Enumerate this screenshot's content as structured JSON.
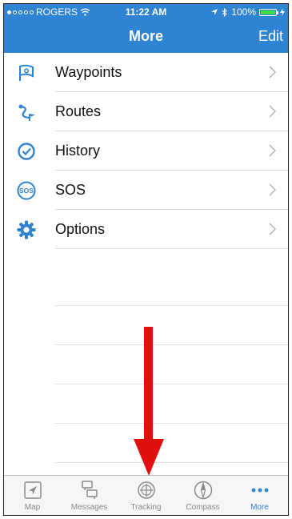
{
  "statusbar": {
    "carrier": "ROGERS",
    "time": "11:22 AM",
    "battery": "100%"
  },
  "header": {
    "title": "More",
    "edit_label": "Edit"
  },
  "menu": {
    "items": [
      {
        "label": "Waypoints",
        "icon": "waypoint-flag-icon"
      },
      {
        "label": "Routes",
        "icon": "route-icon"
      },
      {
        "label": "History",
        "icon": "history-clock-icon"
      },
      {
        "label": "SOS",
        "icon": "sos-icon"
      },
      {
        "label": "Options",
        "icon": "gear-icon"
      }
    ]
  },
  "tabs": [
    {
      "label": "Map",
      "icon": "map-arrow-icon"
    },
    {
      "label": "Messages",
      "icon": "messages-icon"
    },
    {
      "label": "Tracking",
      "icon": "tracking-crosshair-icon"
    },
    {
      "label": "Compass",
      "icon": "compass-icon"
    },
    {
      "label": "More",
      "icon": "more-dots-icon",
      "active": true
    }
  ],
  "colors": {
    "accent": "#2f83d3",
    "annotation_arrow": "#e01010",
    "inactive_tab": "#8a8a8a"
  }
}
